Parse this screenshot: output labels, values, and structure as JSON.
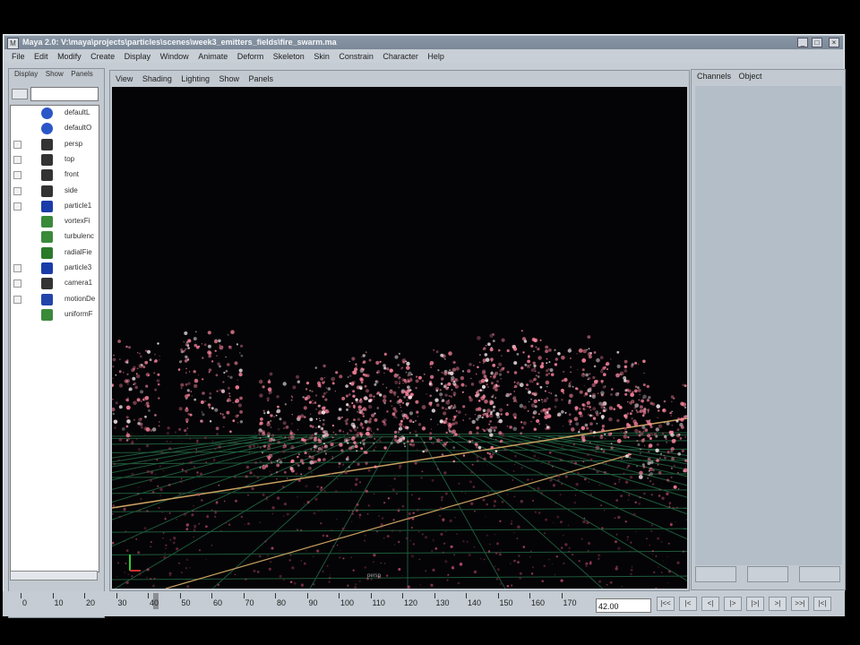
{
  "window": {
    "title": "Maya 2.0: V:\\maya\\projects\\particles\\scenes\\week3_emitters_fields\\fire_swarm.ma",
    "controls": [
      "_",
      "□",
      "×"
    ]
  },
  "menubar": [
    "File",
    "Edit",
    "Modify",
    "Create",
    "Display",
    "Window",
    "Animate",
    "Deform",
    "Skeleton",
    "Skin",
    "Constrain",
    "Character",
    "Help"
  ],
  "outliner": {
    "menu": [
      "Display",
      "Show",
      "Panels"
    ],
    "items": [
      {
        "label": "defaultL",
        "icon": "light-icon",
        "expandable": false
      },
      {
        "label": "defaultO",
        "icon": "light-icon",
        "expandable": false
      },
      {
        "label": "persp",
        "icon": "camera-icon",
        "expandable": true
      },
      {
        "label": "top",
        "icon": "camera-icon",
        "expandable": true
      },
      {
        "label": "front",
        "icon": "camera-icon",
        "expandable": true
      },
      {
        "label": "side",
        "icon": "camera-icon",
        "expandable": true
      },
      {
        "label": "particle1",
        "icon": "particle-icon",
        "expandable": true
      },
      {
        "label": "vortexFi",
        "icon": "field-icon",
        "expandable": false
      },
      {
        "label": "turbulenc",
        "icon": "field-icon",
        "expandable": false
      },
      {
        "label": "radialFie",
        "icon": "radial-field-icon",
        "expandable": false
      },
      {
        "label": "particle3",
        "icon": "particle-icon",
        "expandable": true
      },
      {
        "label": "camera1",
        "icon": "camera-icon",
        "expandable": true
      },
      {
        "label": "motionDe",
        "icon": "curve-icon",
        "expandable": true
      },
      {
        "label": "uniformF",
        "icon": "field-icon",
        "expandable": false
      }
    ]
  },
  "viewport": {
    "menu": [
      "View",
      "Shading",
      "Lighting",
      "Show",
      "Panels"
    ],
    "camera_label": "persp"
  },
  "channel_box": {
    "menu": [
      "Channels",
      "Object"
    ]
  },
  "timeline": {
    "ticks": [
      "0",
      "10",
      "20",
      "30",
      "40",
      "50",
      "60",
      "70",
      "80",
      "90",
      "100",
      "110",
      "120",
      "130",
      "140",
      "150",
      "160",
      "170"
    ],
    "current_frame": "42.00",
    "playback_buttons": [
      "|<<",
      "|<",
      "<|",
      "|>",
      "|>|",
      ">|",
      ">>|",
      "|<|"
    ]
  },
  "colors": {
    "ui_gray": "#c5ccd3",
    "title_blue": "#7b8897",
    "fire_pink": "#ff86a0",
    "grid_green": "#1e5a3a",
    "grid_axis": "#c9a060"
  }
}
